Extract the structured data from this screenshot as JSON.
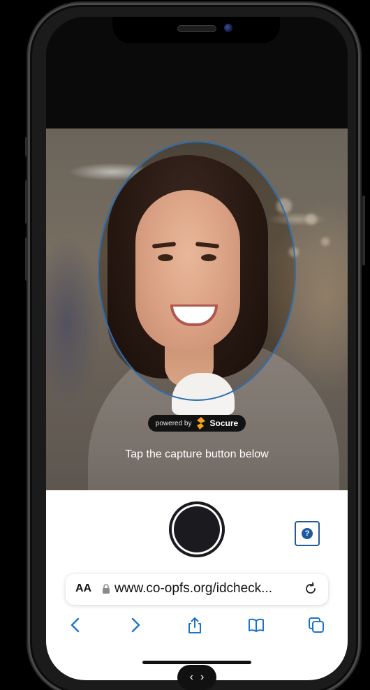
{
  "camera": {
    "powered_by_label": "powered by",
    "brand_name": "Socure",
    "instruction": "Tap the capture button below"
  },
  "capture": {
    "help_glyph": "?"
  },
  "browser": {
    "text_size_label": "AA",
    "url": "www.co-opfs.org/idcheck...",
    "toolbar_icons": [
      "back-icon",
      "forward-icon",
      "share-icon",
      "bookmarks-icon",
      "tabs-icon"
    ]
  },
  "colors": {
    "link_blue": "#1a73c9",
    "oval_outline": "#2d6fb2",
    "help_blue": "#1e5b9e",
    "socure_orange": "#f5a21b"
  }
}
